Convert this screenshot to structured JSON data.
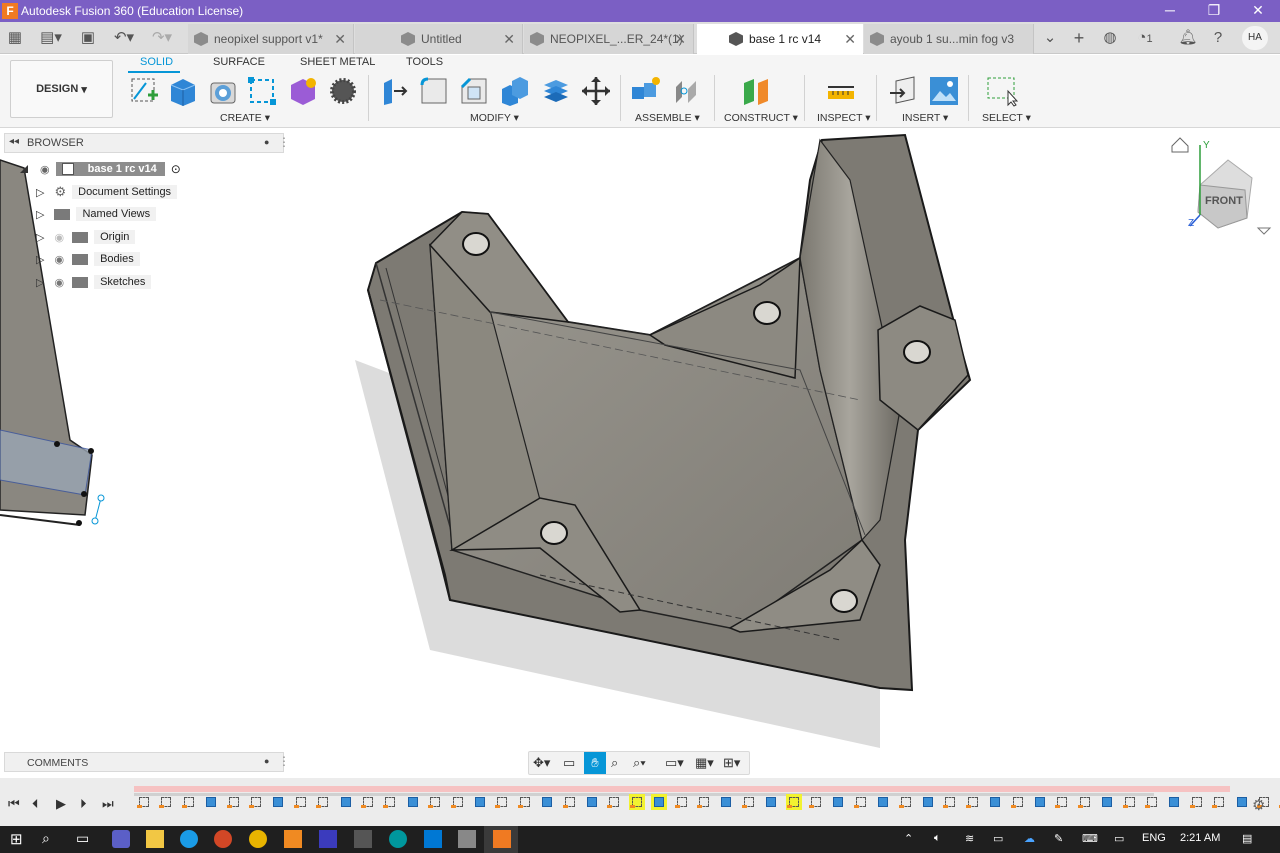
{
  "window": {
    "title": "Autodesk Fusion 360 (Education License)",
    "app_icon": "fusion-app-icon"
  },
  "window_controls": {
    "minimize": "─",
    "maximize": "❐",
    "close": "✕"
  },
  "tabs": [
    {
      "label": "neopixel support v1*",
      "active": false
    },
    {
      "label": "Untitled",
      "active": false
    },
    {
      "label": "NEOPIXEL_...ER_24*(1)",
      "active": false
    },
    {
      "label": "base 1 rc v14",
      "active": true
    },
    {
      "label": "ayoub 1 su...min fog v3",
      "active": false
    }
  ],
  "tabbar_right": {
    "jobs_count": "1",
    "user_initials": "HA"
  },
  "toolbar": {
    "workspace": "DESIGN",
    "workspace_tabs": [
      "SOLID",
      "SURFACE",
      "SHEET METAL",
      "TOOLS"
    ],
    "groups": [
      "CREATE",
      "MODIFY",
      "ASSEMBLE",
      "CONSTRUCT",
      "INSPECT",
      "INSERT",
      "SELECT"
    ]
  },
  "browser": {
    "title": "BROWSER",
    "root": "base 1 rc v14",
    "items": [
      "Document Settings",
      "Named Views",
      "Origin",
      "Bodies",
      "Sketches"
    ]
  },
  "viewcube": {
    "face": "FRONT",
    "axes": {
      "y": "Y",
      "z": "Z"
    }
  },
  "comments": {
    "title": "COMMENTS"
  },
  "taskbar": {
    "language": "ENG",
    "time": "2:21 AM"
  },
  "colors": {
    "title_bar": "#7b5fc4",
    "accent": "#0696d7",
    "model": "#8f8c84",
    "timeline_highlight": "#f2f230"
  }
}
